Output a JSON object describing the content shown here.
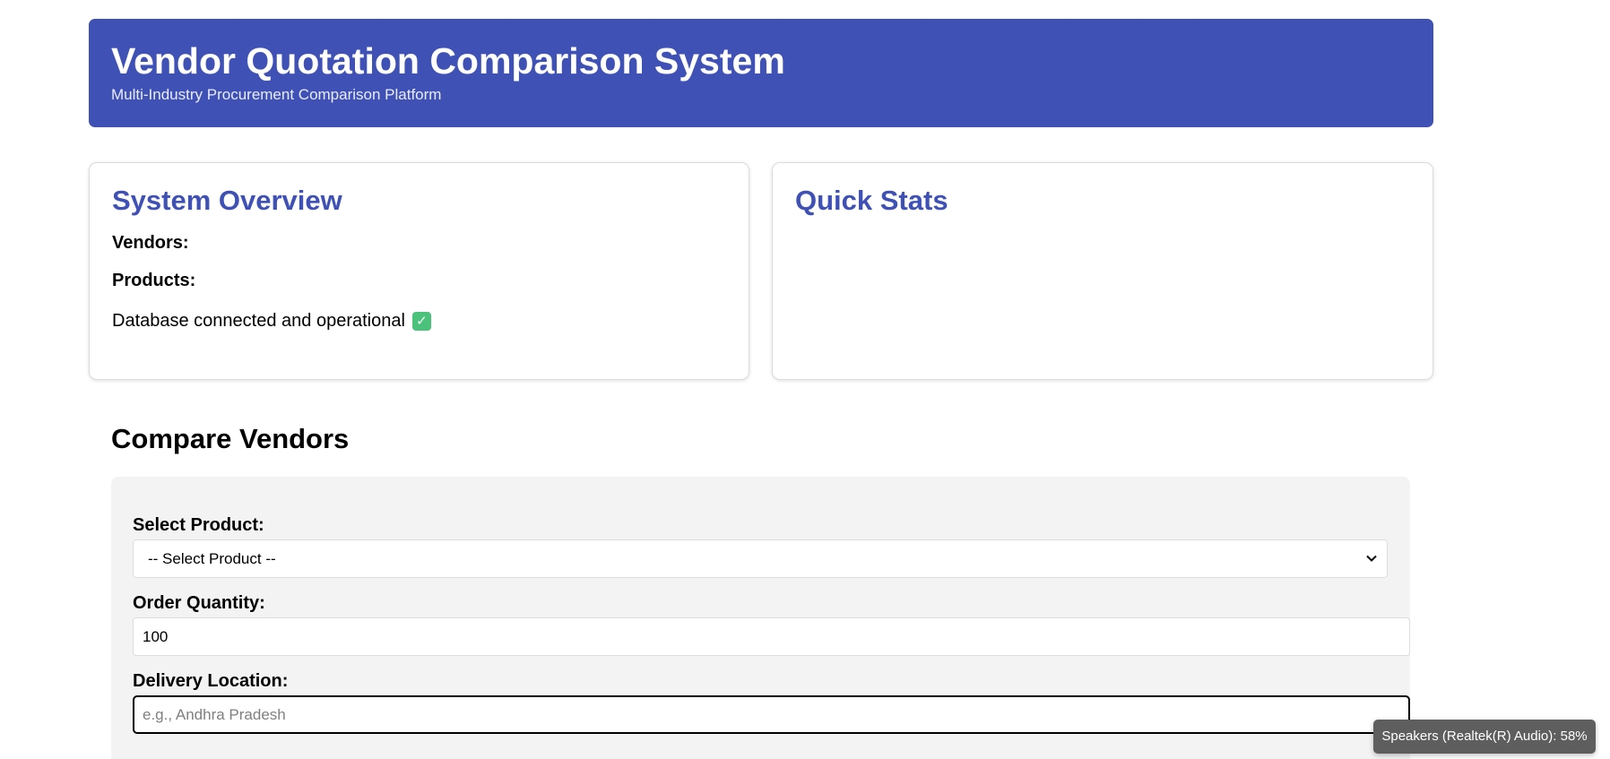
{
  "header": {
    "title": "Vendor Quotation Comparison System",
    "subtitle": "Multi-Industry Procurement Comparison Platform"
  },
  "overview": {
    "title": "System Overview",
    "vendors_label": "Vendors:",
    "products_label": "Products:",
    "status_text": "Database connected and operational",
    "status_icon": "check-box-icon",
    "status_icon_color": "#4ac27c"
  },
  "quick_stats": {
    "title": "Quick Stats"
  },
  "compare": {
    "title": "Compare Vendors",
    "product_label": "Select Product:",
    "product_selected": "-- Select Product --",
    "quantity_label": "Order Quantity:",
    "quantity_value": "100",
    "location_label": "Delivery Location:",
    "location_placeholder": "e.g., Andhra Pradesh"
  },
  "toast": {
    "text": "Speakers (Realtek(R) Audio): 58%"
  },
  "colors": {
    "accent": "#3f51b5",
    "panel_bg": "#f3f3f3"
  }
}
